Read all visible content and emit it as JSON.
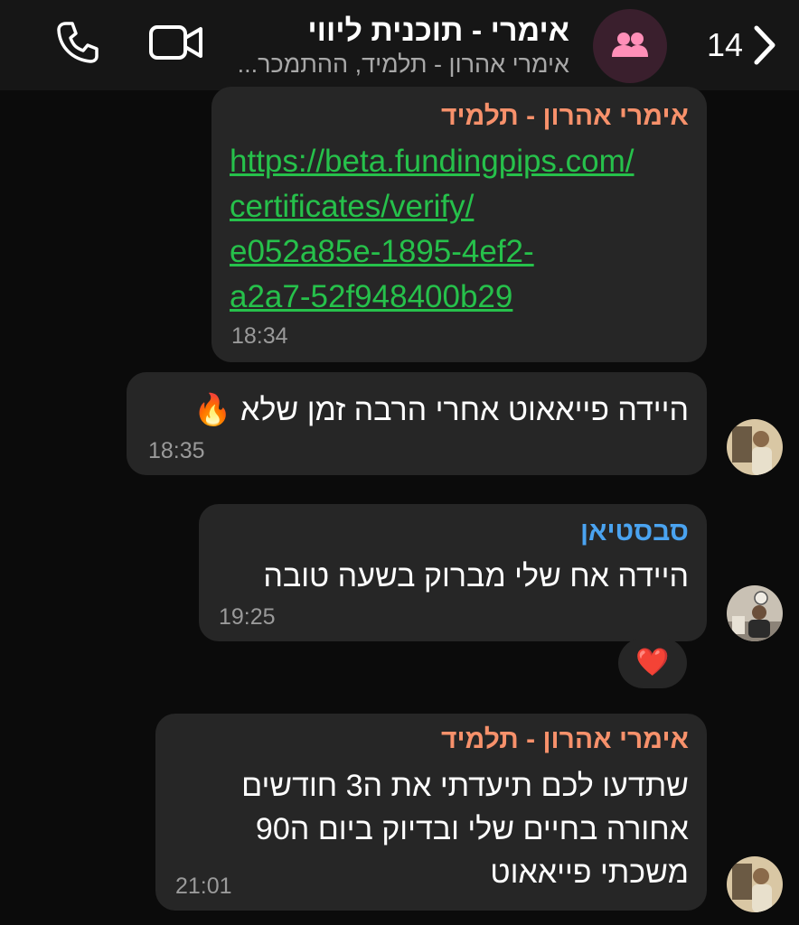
{
  "header": {
    "back_count": "14",
    "title": "אימרי - תוכנית ליווי",
    "subtitle": "אימרי אהרון - תלמיד, ההתמכר...",
    "accent": "#ff8fb8"
  },
  "messages": [
    {
      "sender": "אימרי אהרון - תלמיד",
      "sender_color": "#f7916b",
      "link": "https://beta.fundingpips.com/certificates/verify/e052a85e-1895-4ef2-a2a7-52f948400b29",
      "link_lines": [
        "https://beta.fundingpips.com/",
        "certificates/verify/",
        "e052a85e-1895-4ef2-",
        "a2a7-52f948400b29"
      ],
      "time": "18:34"
    },
    {
      "text": "היידה פייאאוט אחרי הרבה זמן שלא 🔥",
      "time": "18:35"
    },
    {
      "sender": "סבסטיאן",
      "sender_color": "#4aa3f0",
      "text": "היידה אח שלי מברוק בשעה טובה",
      "time": "19:25",
      "reaction": "❤️"
    },
    {
      "sender": "אימרי אהרון - תלמיד",
      "sender_color": "#f7916b",
      "text_lines": [
        "שתדעו לכם תיעדתי את ה3 חודשים",
        "אחורה בחיים שלי ובדיוק ביום ה90",
        "משכתי פייאאוט"
      ],
      "time": "21:01"
    }
  ]
}
